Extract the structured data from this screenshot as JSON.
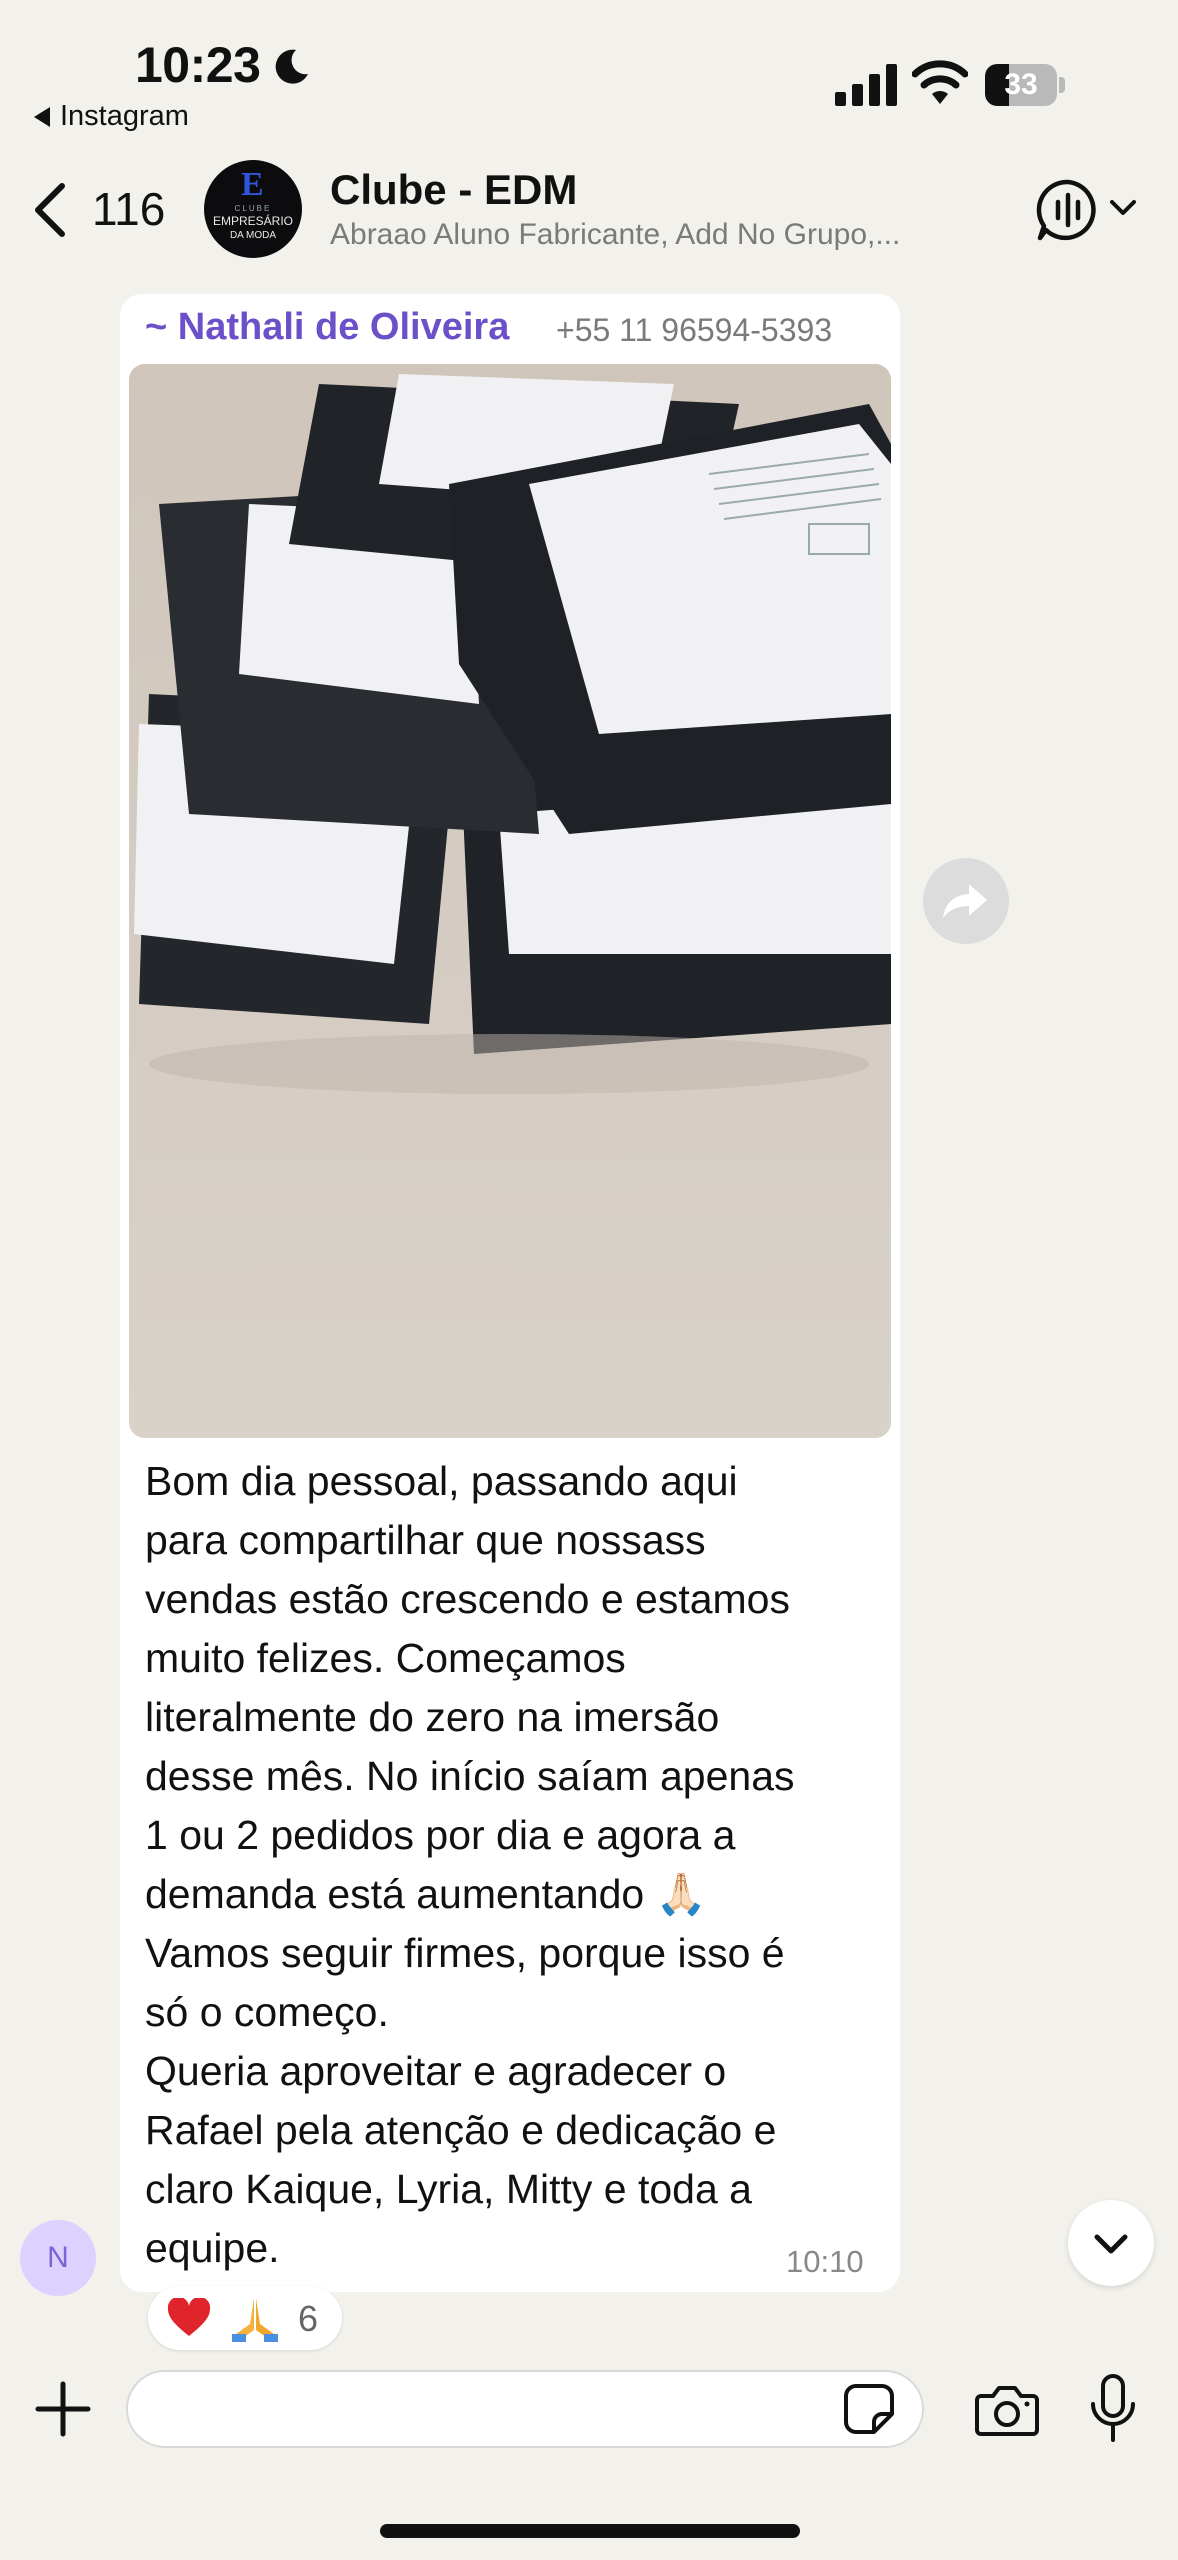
{
  "status_bar": {
    "time": "10:23",
    "back_app": "Instagram",
    "battery": "33",
    "battery_level": 0.33
  },
  "header": {
    "back_count": "116",
    "title": "Clube - EDM",
    "subtitle": "Abraao Aluno Fabricante, Add No Grupo,...",
    "avatar_logo": {
      "letter": "E",
      "line1": "CLUBE",
      "line2": "EMPRESÁRIO",
      "line3": "DA MODA"
    }
  },
  "message": {
    "sender": "~ Nathali de Oliveira",
    "sender_phone": "+55 11 96594-5393",
    "text": "Bom dia pessoal, passando aqui\npara compartilhar que nossass\nvendas estão crescendo e estamos\nmuito felizes. Começamos\nliteralmente do zero na imersão\ndesse mês. No início saíam apenas\n1 ou 2 pedidos por dia e agora a\ndemanda está aumentando 🙏🏻\nVamos seguir firmes, porque isso é\nsó o começo.\nQueria aproveitar e agradecer o\nRafael pela atenção e dedicação e\nclaro Kaique, Lyria, Mitty e toda a\nequipe.",
    "time": "10:10",
    "reaction_count": "6",
    "sender_initial": "N"
  },
  "icons": {
    "moon": "moon-icon",
    "signal": "cellular-signal-icon",
    "wifi": "wifi-icon",
    "battery": "battery-icon",
    "back": "chevron-left-icon",
    "audio": "audio-call-icon",
    "forward": "forward-icon",
    "scroll_down": "chevron-down-icon",
    "plus": "plus-icon",
    "sticker": "sticker-icon",
    "camera": "camera-icon",
    "mic": "microphone-icon"
  },
  "colors": {
    "background": "#f3f1ec",
    "sender_name": "#6b50c9",
    "bubble": "#ffffff"
  }
}
